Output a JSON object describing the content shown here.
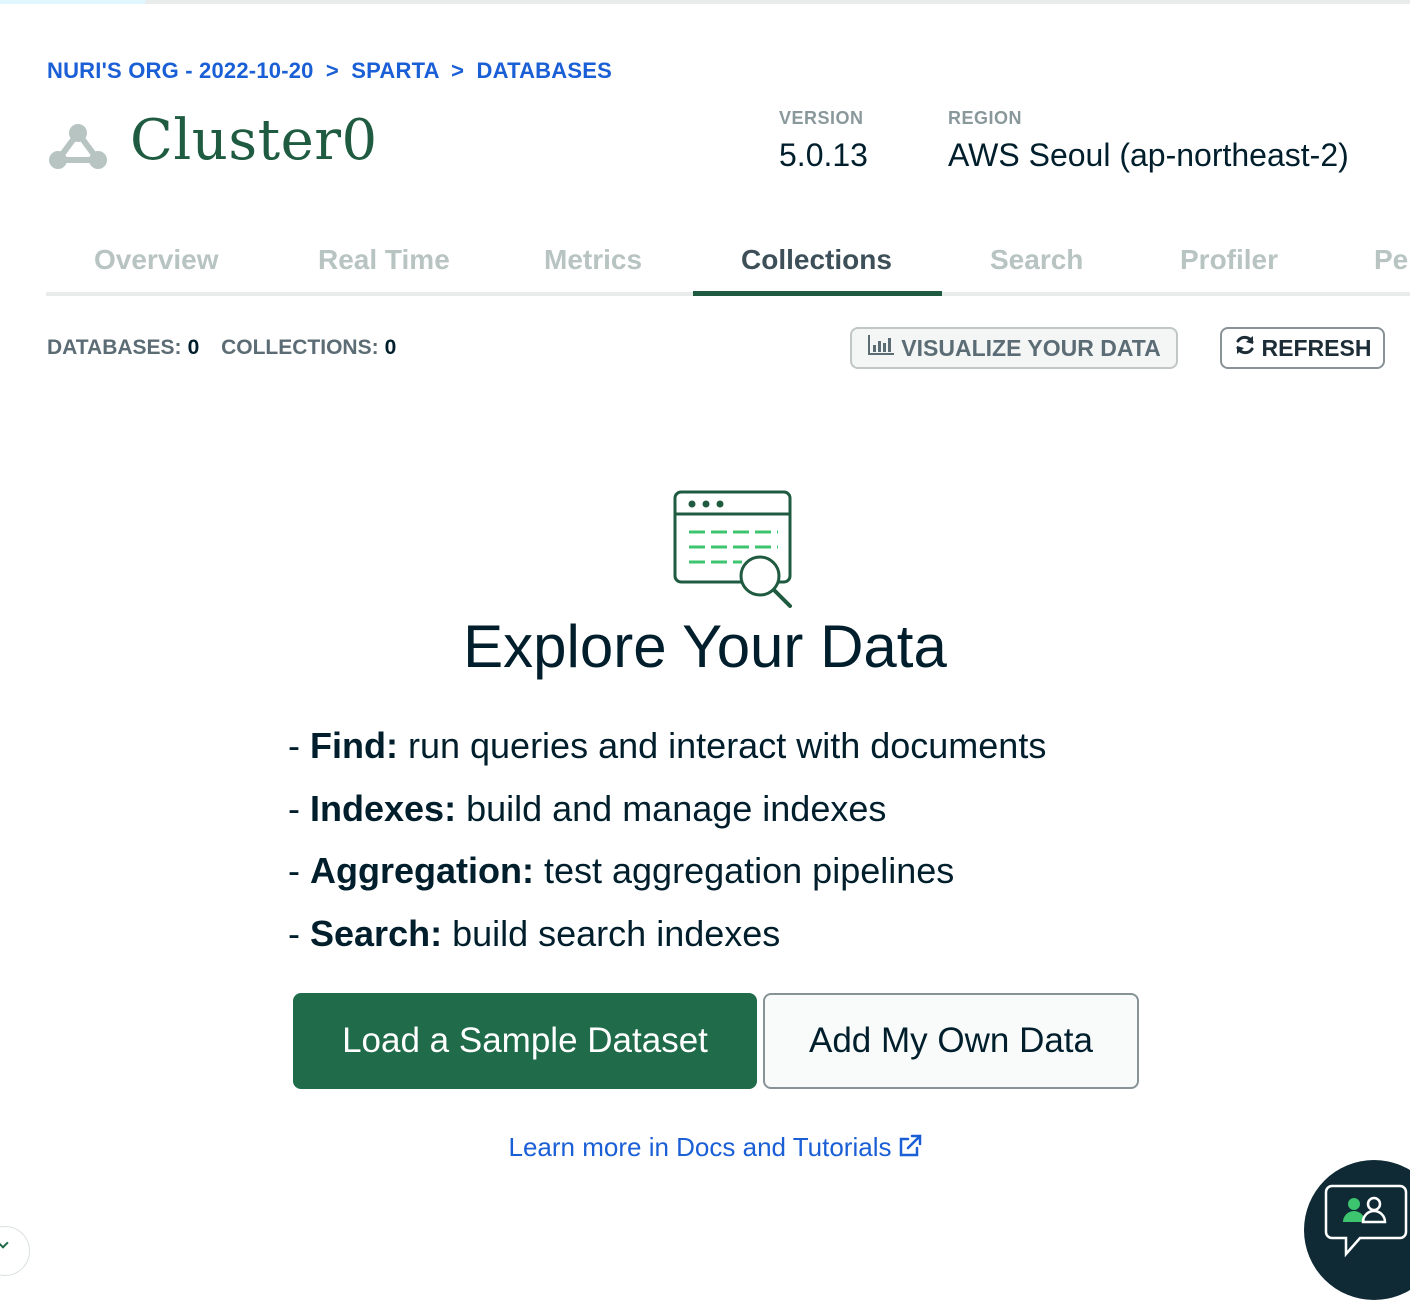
{
  "breadcrumb": {
    "org": "NURI'S ORG - 2022-10-20",
    "project": "SPARTA",
    "section": "DATABASES",
    "separator": ">"
  },
  "cluster": {
    "name": "Cluster0",
    "icon": "cluster-icon"
  },
  "meta": {
    "version_label": "VERSION",
    "version_value": "5.0.13",
    "region_label": "REGION",
    "region_value": "AWS Seoul (ap-northeast-2)"
  },
  "tabs": [
    {
      "label": "Overview"
    },
    {
      "label": "Real Time"
    },
    {
      "label": "Metrics"
    },
    {
      "label": "Collections",
      "active": true
    },
    {
      "label": "Search"
    },
    {
      "label": "Profiler"
    },
    {
      "label": "Per"
    }
  ],
  "counts": {
    "databases_label": "DATABASES:",
    "databases_value": "0",
    "collections_label": "COLLECTIONS:",
    "collections_value": "0"
  },
  "actions": {
    "visualize_label": "VISUALIZE YOUR DATA",
    "visualize_icon": "bar-chart-icon",
    "refresh_label": "REFRESH",
    "refresh_icon": "refresh-icon"
  },
  "empty_state": {
    "icon": "data-explorer-icon",
    "title": "Explore Your Data",
    "features": [
      {
        "prefix": "- ",
        "term": "Find:",
        "desc": " run queries and interact with documents"
      },
      {
        "prefix": "- ",
        "term": "Indexes:",
        "desc": " build and manage indexes"
      },
      {
        "prefix": "- ",
        "term": "Aggregation:",
        "desc": " test aggregation pipelines"
      },
      {
        "prefix": "- ",
        "term": "Search:",
        "desc": " build search indexes"
      }
    ],
    "primary_button": "Load a Sample Dataset",
    "secondary_button": "Add My Own Data",
    "docs_link": "Learn more in Docs and Tutorials"
  },
  "colors": {
    "brand_green": "#1f6b4a",
    "link_blue": "#1a5fd6",
    "text_dark": "#001e2b"
  }
}
